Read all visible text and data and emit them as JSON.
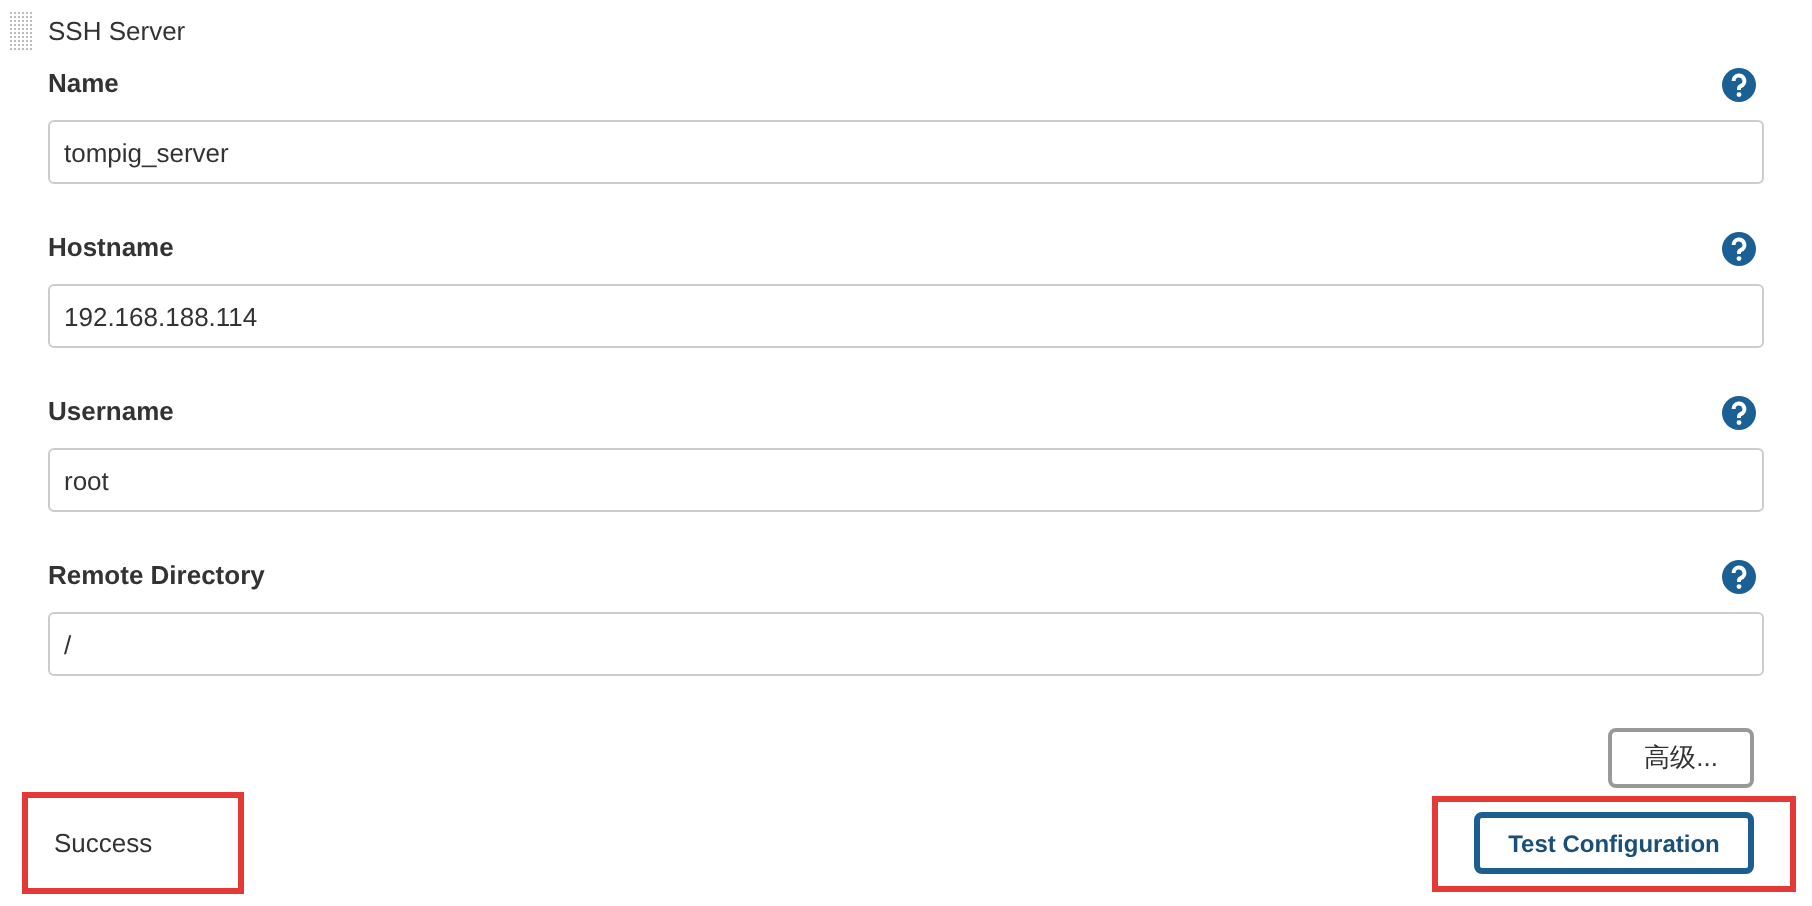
{
  "section": {
    "title": "SSH Server"
  },
  "fields": [
    {
      "label": "Name",
      "value": "tompig_server"
    },
    {
      "label": "Hostname",
      "value": "192.168.188.114"
    },
    {
      "label": "Username",
      "value": "root"
    },
    {
      "label": "Remote Directory",
      "value": "/"
    }
  ],
  "advanced_button": "高级...",
  "result": {
    "text": "Success",
    "highlighted": true
  },
  "test_button": {
    "label": "Test Configuration",
    "highlighted": true
  }
}
